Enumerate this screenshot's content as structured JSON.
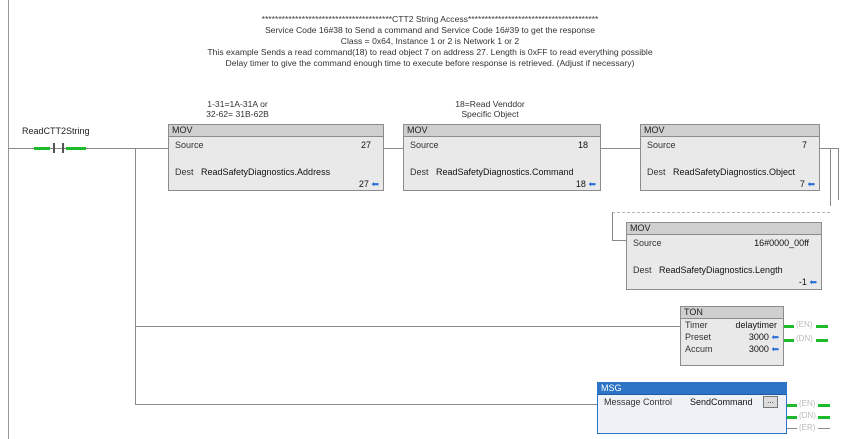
{
  "rung_comment": {
    "lines": [
      "***************************************CTT2 String Access***************************************",
      "Service Code 16#38 to Send a command and Service Code 16#39 to get the response",
      "Class = 0x64, Instance 1 or 2 is Network 1 or 2",
      "This example Sends a read command(18) to read object 7 on address 27. Length is 0xFF to read everything possible",
      "Delay timer to give the command enough time to execute before response is retrieved. (Adjust if necessary)"
    ]
  },
  "contact": {
    "tag": "ReadCTT2String"
  },
  "notes": {
    "address": [
      "1-31=1A-31A or",
      "32-62= 31B-62B"
    ],
    "command": [
      "18=Read Venddor",
      "Specific Object"
    ]
  },
  "mov1": {
    "title": "MOV",
    "source_label": "Source",
    "source_value": "27",
    "dest_label": "Dest",
    "dest_tag": "ReadSafetyDiagnostics.Address",
    "dest_value": "27"
  },
  "mov2": {
    "title": "MOV",
    "source_label": "Source",
    "source_value": "18",
    "dest_label": "Dest",
    "dest_tag": "ReadSafetyDiagnostics.Command",
    "dest_value": "18"
  },
  "mov3": {
    "title": "MOV",
    "source_label": "Source",
    "source_value": "7",
    "dest_label": "Dest",
    "dest_tag": "ReadSafetyDiagnostics.Object",
    "dest_value": "7"
  },
  "mov4": {
    "title": "MOV",
    "source_label": "Source",
    "source_value": "16#0000_00ff",
    "dest_label": "Dest",
    "dest_tag": "ReadSafetyDiagnostics.Length",
    "dest_value": "-1"
  },
  "ton": {
    "title": "TON",
    "timer_label": "Timer",
    "timer_tag": "delaytimer",
    "preset_label": "Preset",
    "preset_value": "3000",
    "accum_label": "Accum",
    "accum_value": "3000",
    "en": "EN",
    "dn": "DN"
  },
  "msg": {
    "title": "MSG",
    "control_label": "Message Control",
    "control_tag": "SendCommand",
    "button": "...",
    "en": "EN",
    "dn": "DN",
    "er": "ER"
  },
  "colors": {
    "energized": "#1dbb2a",
    "msg_accent": "#2d74c7",
    "dest_arrow": "#2a6fd6"
  }
}
